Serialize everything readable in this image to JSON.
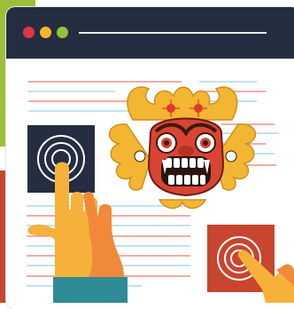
{
  "window": {
    "title_dots": [
      "close",
      "minimize",
      "maximize"
    ]
  },
  "colors": {
    "titlebar": "#242e40",
    "dot_close": "#e0344b",
    "dot_minimize": "#f1b72e",
    "dot_maximize": "#8fc43e",
    "accent_green": "#9cbf3b",
    "accent_red": "#c8452f",
    "navy_tile": "#242e40",
    "hand_yellow": "#f6b13a",
    "hand_orange": "#f0893a",
    "cuff_teal": "#2f8b96"
  },
  "icons": [
    "target-icon",
    "target-icon",
    "barong-mask-icon",
    "pointing-hand-icon",
    "pointing-hand-icon"
  ]
}
